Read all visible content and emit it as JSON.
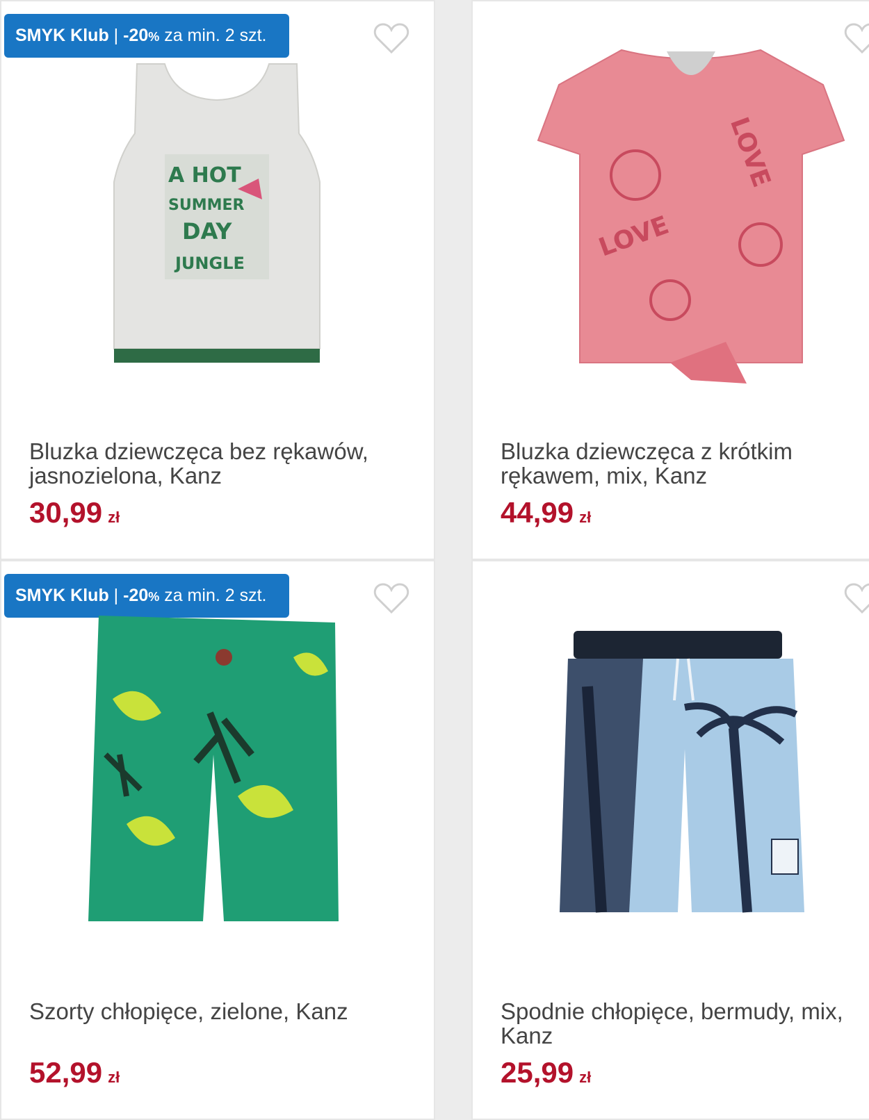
{
  "products": [
    {
      "badge": {
        "brand": "SMYK Klub",
        "sep": " | ",
        "discount": "-20",
        "pct": "%",
        "rest": " za min. 2 szt."
      },
      "title": "Bluzka dziewczęca bez rękawów, jasnozielona, Kanz",
      "price": "30,99",
      "currency": "zł",
      "image_icon": "sleeveless-top-image"
    },
    {
      "title": "Bluzka dziewczęca z krótkim rękawem, mix, Kanz",
      "price": "44,99",
      "currency": "zł",
      "image_icon": "short-sleeve-top-image"
    },
    {
      "badge": {
        "brand": "SMYK Klub",
        "sep": " | ",
        "discount": "-20",
        "pct": "%",
        "rest": " za min. 2 szt."
      },
      "title": "Szorty chłopięce, zielone, Kanz",
      "price": "52,99",
      "currency": "zł",
      "image_icon": "green-shorts-image"
    },
    {
      "title": "Spodnie chłopięce, bermudy, mix, Kanz",
      "price": "25,99",
      "currency": "zł",
      "image_icon": "palm-shorts-image"
    }
  ],
  "colors": {
    "badge": "#1976c4",
    "price": "#b3122b",
    "heart": "#cfcfcf"
  }
}
